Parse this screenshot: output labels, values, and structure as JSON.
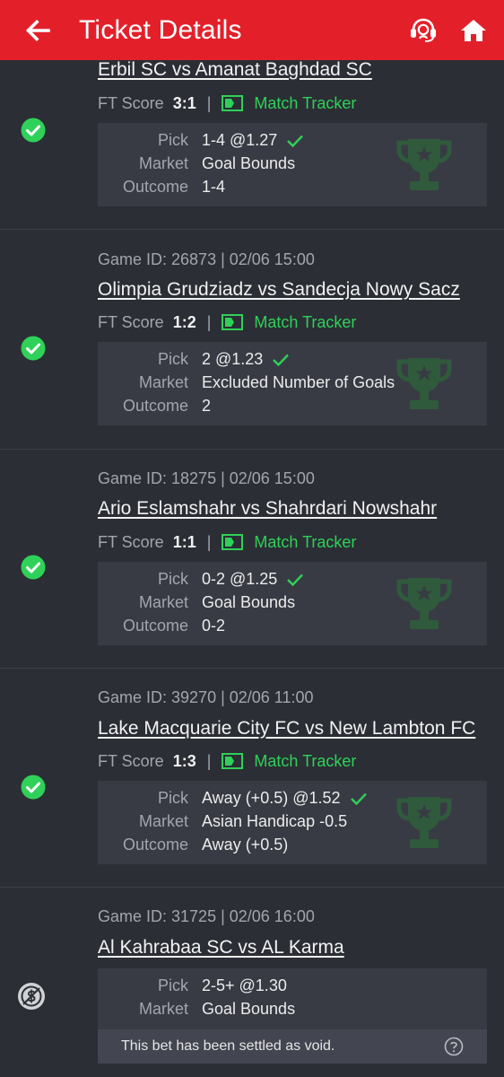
{
  "header": {
    "title": "Ticket Details",
    "back_icon": "arrow-left-icon",
    "support_icon": "headset-icon",
    "home_icon": "home-icon",
    "bg_color": "#e3202a"
  },
  "labels": {
    "ft_score": "FT Score",
    "separator": "|",
    "match_tracker": "Match Tracker",
    "pick": "Pick",
    "market": "Market",
    "outcome": "Outcome"
  },
  "colors": {
    "won": "#2fd158",
    "void": "#d0d2d6"
  },
  "matches": [
    {
      "status": "won",
      "game_id": "",
      "teams": "Erbil SC vs Amanat Baghdad SC",
      "score": "3:1",
      "pick": "1-4 @1.27",
      "market": "Goal Bounds",
      "outcome": "1-4"
    },
    {
      "status": "won",
      "game_id": "Game ID: 26873 | 02/06 15:00",
      "teams": "Olimpia Grudziadz vs Sandecja Nowy Sacz",
      "score": "1:2",
      "pick": "2 @1.23",
      "market": "Excluded Number of Goals",
      "outcome": "2"
    },
    {
      "status": "won",
      "game_id": "Game ID: 18275 | 02/06 15:00",
      "teams": "Ario Eslamshahr vs Shahrdari Nowshahr",
      "score": "1:1",
      "pick": "0-2 @1.25",
      "market": "Goal Bounds",
      "outcome": "0-2"
    },
    {
      "status": "won",
      "game_id": "Game ID: 39270 | 02/06 11:00",
      "teams": "Lake Macquarie City FC vs New Lambton FC",
      "score": "1:3",
      "pick": "Away (+0.5) @1.52",
      "market": "Asian Handicap -0.5",
      "outcome": "Away (+0.5)"
    },
    {
      "status": "void",
      "game_id": "Game ID: 31725 | 02/06 16:00",
      "teams": "Al Kahrabaa SC vs AL Karma",
      "pick": "2-5+ @1.30",
      "market": "Goal Bounds",
      "void_note": "This bet has been settled as void."
    }
  ]
}
